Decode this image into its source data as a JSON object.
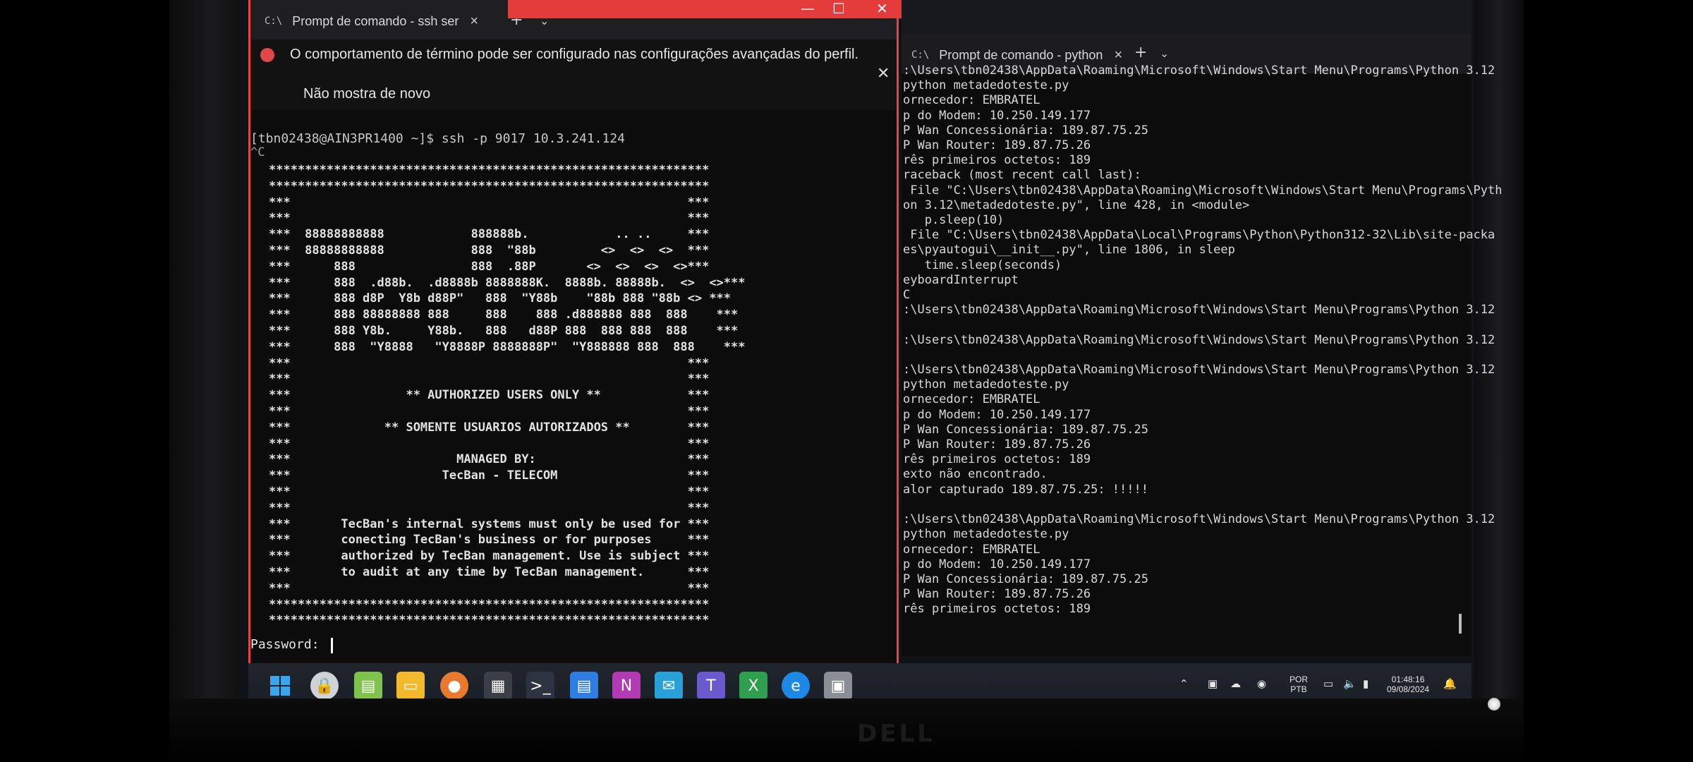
{
  "left_window": {
    "tab_title": "Prompt de comando - ssh  ser",
    "notice": {
      "message": "O comportamento de término pode ser configurado nas configurações avançadas do perfil.",
      "dismiss": "Não mostra de novo"
    },
    "prompt": "[tbn02438@AIN3PR1400 ~]$ ssh -p 9017 10.3.241.124",
    "ctrl_c": "^C",
    "banner_lines": [
      "*************************************************************",
      "*************************************************************",
      "***                                                       ***",
      "***                                                       ***",
      "***  88888888888            888888b.            .. ..     ***",
      "***  88888888888            888  \"88b         <>  <>  <>  ***",
      "***      888                888  .88P       <>  <>  <>  <>***",
      "***      888  .d88b.  .d8888b 8888888K.  8888b. 88888b.  <>  <>***",
      "***      888 d8P  Y8b d88P\"   888  \"Y88b    \"88b 888 \"88b <> ***",
      "***      888 88888888 888     888    888 .d888888 888  888    ***",
      "***      888 Y8b.     Y88b.   888   d88P 888  888 888  888    ***",
      "***      888  \"Y8888   \"Y8888P 8888888P\"  \"Y888888 888  888    ***",
      "***                                                       ***",
      "***                                                       ***",
      "***                ** AUTHORIZED USERS ONLY **            ***",
      "***                                                       ***",
      "***             ** SOMENTE USUARIOS AUTORIZADOS **        ***",
      "***                                                       ***",
      "***                       MANAGED BY:                     ***",
      "***                     TecBan - TELECOM                  ***",
      "***                                                       ***",
      "***                                                       ***",
      "***       TecBan's internal systems must only be used for ***",
      "***       conecting TecBan's business or for purposes     ***",
      "***       authorized by TecBan management. Use is subject ***",
      "***       to audit at any time by TecBan management.      ***",
      "***                                                       ***",
      "*************************************************************",
      "*************************************************************"
    ],
    "password_prompt": "Password: "
  },
  "right_window": {
    "tab_title": "Prompt de comando - python",
    "lines": [
      ":\\Users\\tbn02438\\AppData\\Roaming\\Microsoft\\Windows\\Start Menu\\Programs\\Python 3.12",
      "python metadedoteste.py",
      "ornecedor: EMBRATEL",
      "p do Modem: 10.250.149.177",
      "P Wan Concessionária: 189.87.75.25",
      "P Wan Router: 189.87.75.26",
      "rês primeiros octetos: 189",
      "raceback (most recent call last):",
      " File \"C:\\Users\\tbn02438\\AppData\\Roaming\\Microsoft\\Windows\\Start Menu\\Programs\\Pyth",
      "on 3.12\\metadedoteste.py\", line 428, in <module>",
      "   p.sleep(10)",
      " File \"C:\\Users\\tbn02438\\AppData\\Local\\Programs\\Python\\Python312-32\\Lib\\site-packa",
      "es\\pyautogui\\__init__.py\", line 1806, in sleep",
      "   time.sleep(seconds)",
      "eyboardInterrupt",
      "C",
      ":\\Users\\tbn02438\\AppData\\Roaming\\Microsoft\\Windows\\Start Menu\\Programs\\Python 3.12",
      "",
      ":\\Users\\tbn02438\\AppData\\Roaming\\Microsoft\\Windows\\Start Menu\\Programs\\Python 3.12",
      "",
      ":\\Users\\tbn02438\\AppData\\Roaming\\Microsoft\\Windows\\Start Menu\\Programs\\Python 3.12",
      "python metadedoteste.py",
      "ornecedor: EMBRATEL",
      "p do Modem: 10.250.149.177",
      "P Wan Concessionária: 189.87.75.25",
      "P Wan Router: 189.87.75.26",
      "rês primeiros octetos: 189",
      "exto não encontrado.",
      "alor capturado 189.87.75.25: !!!!!",
      "",
      ":\\Users\\tbn02438\\AppData\\Roaming\\Microsoft\\Windows\\Start Menu\\Programs\\Python 3.12",
      "python metadedoteste.py",
      "ornecedor: EMBRATEL",
      "p do Modem: 10.250.149.177",
      "P Wan Concessionária: 189.87.75.25",
      "P Wan Router: 189.87.75.26",
      "rês primeiros octetos: 189"
    ]
  },
  "taskbar": {
    "language": "POR",
    "layout": "PTB",
    "time": "01:48:16",
    "date": "09/08/2024"
  },
  "monitor_brand": "DELL",
  "colors": {
    "accent_red": "#e43c3a",
    "terminal_bg": "#0c0c0c"
  }
}
